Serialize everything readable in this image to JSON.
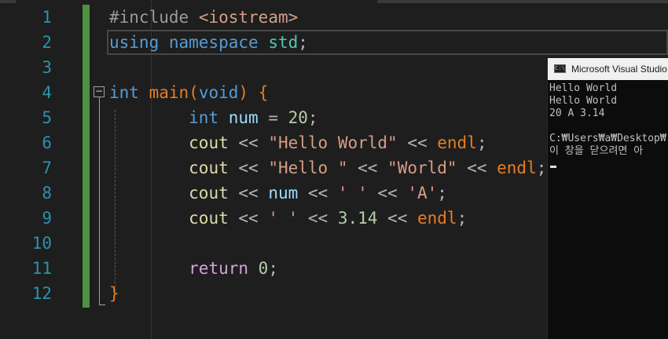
{
  "editor": {
    "line_numbers": [
      "1",
      "2",
      "3",
      "4",
      "5",
      "6",
      "7",
      "8",
      "9",
      "10",
      "11",
      "12"
    ],
    "lines": [
      {
        "tokens": [
          {
            "t": "#include",
            "c": "pp"
          },
          {
            "t": " ",
            "c": ""
          },
          {
            "t": "<iostream>",
            "c": "ppv"
          }
        ]
      },
      {
        "tokens": [
          {
            "t": "using",
            "c": "kw"
          },
          {
            "t": " ",
            "c": ""
          },
          {
            "t": "namespace",
            "c": "kw"
          },
          {
            "t": " ",
            "c": ""
          },
          {
            "t": "std",
            "c": "ns"
          },
          {
            "t": ";",
            "c": "op"
          }
        ]
      },
      {
        "tokens": []
      },
      {
        "tokens": [
          {
            "t": "int",
            "c": "kw"
          },
          {
            "t": " ",
            "c": ""
          },
          {
            "t": "main",
            "c": "fn"
          },
          {
            "t": "(",
            "c": "fn"
          },
          {
            "t": "void",
            "c": "kw"
          },
          {
            "t": ")",
            "c": "fn"
          },
          {
            "t": " ",
            "c": ""
          },
          {
            "t": "{",
            "c": "fn"
          }
        ]
      },
      {
        "tokens": [
          {
            "t": "        ",
            "c": ""
          },
          {
            "t": "int",
            "c": "kw"
          },
          {
            "t": " ",
            "c": ""
          },
          {
            "t": "num",
            "c": "var"
          },
          {
            "t": " = ",
            "c": "op"
          },
          {
            "t": "20",
            "c": "num"
          },
          {
            "t": ";",
            "c": "op"
          }
        ]
      },
      {
        "tokens": [
          {
            "t": "        ",
            "c": ""
          },
          {
            "t": "cout",
            "c": "obj"
          },
          {
            "t": " << ",
            "c": "op"
          },
          {
            "t": "\"Hello World\"",
            "c": "str"
          },
          {
            "t": " << ",
            "c": "op"
          },
          {
            "t": "endl",
            "c": "fn"
          },
          {
            "t": ";",
            "c": "op"
          }
        ]
      },
      {
        "tokens": [
          {
            "t": "        ",
            "c": ""
          },
          {
            "t": "cout",
            "c": "obj"
          },
          {
            "t": " << ",
            "c": "op"
          },
          {
            "t": "\"Hello \"",
            "c": "str"
          },
          {
            "t": " << ",
            "c": "op"
          },
          {
            "t": "\"World\"",
            "c": "str"
          },
          {
            "t": " << ",
            "c": "op"
          },
          {
            "t": "endl",
            "c": "fn"
          },
          {
            "t": ";",
            "c": "op"
          }
        ]
      },
      {
        "tokens": [
          {
            "t": "        ",
            "c": ""
          },
          {
            "t": "cout",
            "c": "obj"
          },
          {
            "t": " << ",
            "c": "op"
          },
          {
            "t": "num",
            "c": "var"
          },
          {
            "t": " << ",
            "c": "op"
          },
          {
            "t": "' '",
            "c": "str"
          },
          {
            "t": " << ",
            "c": "op"
          },
          {
            "t": "'A'",
            "c": "str"
          },
          {
            "t": ";",
            "c": "op"
          }
        ]
      },
      {
        "tokens": [
          {
            "t": "        ",
            "c": ""
          },
          {
            "t": "cout",
            "c": "obj"
          },
          {
            "t": " << ",
            "c": "op"
          },
          {
            "t": "' '",
            "c": "str"
          },
          {
            "t": " << ",
            "c": "op"
          },
          {
            "t": "3.14",
            "c": "num"
          },
          {
            "t": " << ",
            "c": "op"
          },
          {
            "t": "endl",
            "c": "fn"
          },
          {
            "t": ";",
            "c": "op"
          }
        ]
      },
      {
        "tokens": []
      },
      {
        "tokens": [
          {
            "t": "        ",
            "c": ""
          },
          {
            "t": "return",
            "c": "ret"
          },
          {
            "t": " ",
            "c": ""
          },
          {
            "t": "0",
            "c": "num"
          },
          {
            "t": ";",
            "c": "op"
          }
        ]
      },
      {
        "tokens": [
          {
            "t": "}",
            "c": "fn"
          }
        ]
      }
    ],
    "fold_glyph": "−"
  },
  "console": {
    "icon_label": "C:\\",
    "title": "Microsoft Visual Studio",
    "lines": [
      "Hello World",
      "Hello World",
      "20 A 3.14",
      "",
      "C:₩Users₩a₩Desktop₩",
      "이 창을 닫으려면 아"
    ]
  },
  "colors": {
    "background": "#1e1e1e",
    "line_number": "#2b91af",
    "keyword": "#569cd6",
    "string": "#d69d85",
    "number": "#b5cea8",
    "change_bar": "#57a64a",
    "console_bg": "#0c0c0c"
  }
}
